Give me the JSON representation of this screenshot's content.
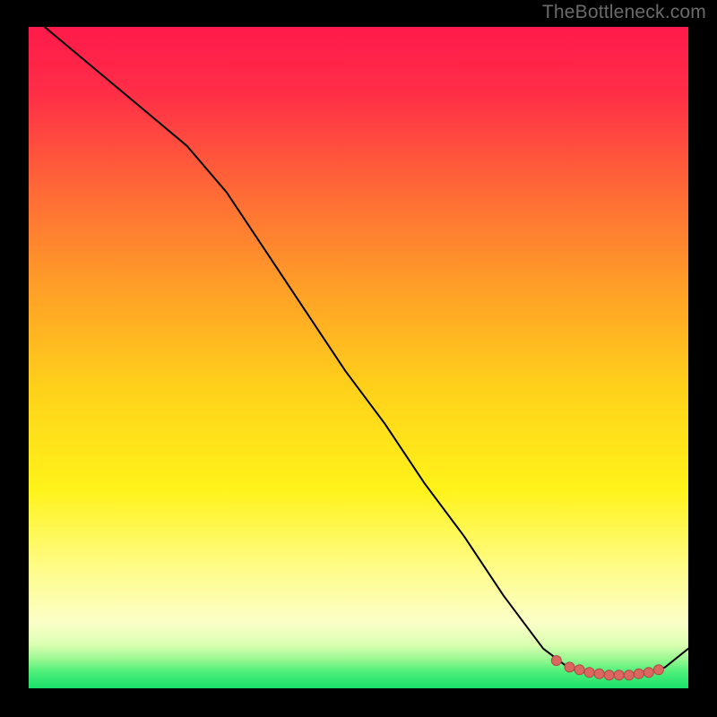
{
  "watermark": "TheBottleneck.com",
  "colors": {
    "top": "#ff1a4b",
    "mid_upper": "#ff8a2a",
    "mid": "#ffe11a",
    "lower": "#fffcb0",
    "green": "#18e06a",
    "curve": "#000000",
    "dot_fill": "#da6860",
    "dot_stroke": "#b24a46"
  },
  "chart_data": {
    "type": "line",
    "title": "",
    "xlabel": "",
    "ylabel": "",
    "xlim": [
      0,
      100
    ],
    "ylim": [
      0,
      100
    ],
    "series": [
      {
        "name": "bottleneck-curve",
        "x": [
          0,
          6,
          12,
          18,
          24,
          30,
          36,
          42,
          48,
          54,
          60,
          66,
          72,
          78,
          82,
          85,
          88,
          91,
          94,
          96.5,
          100
        ],
        "y": [
          102,
          97,
          92,
          87,
          82,
          75,
          66,
          57,
          48,
          40,
          31,
          23,
          14,
          6,
          3,
          2.2,
          2,
          2,
          2.3,
          3.2,
          6
        ]
      }
    ],
    "marker_points": {
      "name": "highlighted-range",
      "x": [
        80,
        82,
        83.5,
        85,
        86.5,
        88,
        89.5,
        91,
        92.5,
        94,
        95.5
      ],
      "y": [
        4.2,
        3.2,
        2.8,
        2.4,
        2.2,
        2.0,
        2.0,
        2.0,
        2.2,
        2.4,
        2.8
      ]
    }
  }
}
